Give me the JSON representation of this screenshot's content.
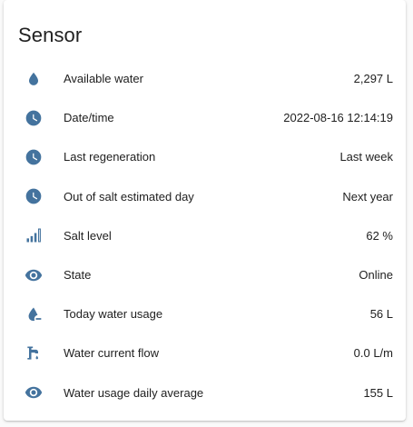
{
  "card": {
    "title": "Sensor"
  },
  "icon_color": "#44739e",
  "entities": [
    {
      "icon": "water-drop-icon",
      "name": "Available water",
      "value": "2,297 L"
    },
    {
      "icon": "clock-icon",
      "name": "Date/time",
      "value": "2022-08-16 12:14:19"
    },
    {
      "icon": "clock-icon",
      "name": "Last regeneration",
      "value": "Last week"
    },
    {
      "icon": "clock-icon",
      "name": "Out of salt estimated day",
      "value": "Next year"
    },
    {
      "icon": "signal-bars-icon",
      "name": "Salt level",
      "value": "62 %"
    },
    {
      "icon": "eye-icon",
      "name": "State",
      "value": "Online"
    },
    {
      "icon": "water-minus-icon",
      "name": "Today water usage",
      "value": "56 L"
    },
    {
      "icon": "faucet-icon",
      "name": "Water current flow",
      "value": "0.0 L/m"
    },
    {
      "icon": "eye-icon",
      "name": "Water usage daily average",
      "value": "155 L"
    }
  ]
}
